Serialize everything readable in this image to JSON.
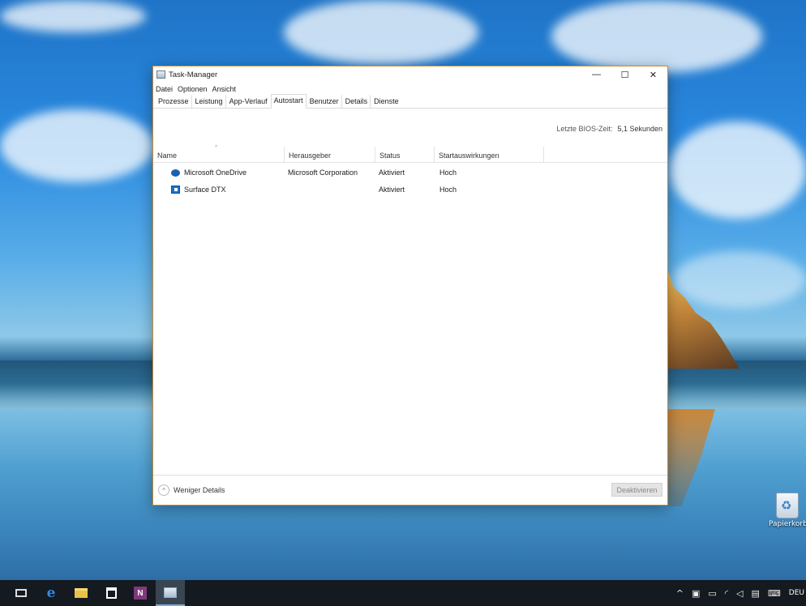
{
  "window": {
    "title": "Task-Manager",
    "controls": {
      "minimize": "—",
      "maximize": "☐",
      "close": "✕"
    }
  },
  "menu": [
    "Datei",
    "Optionen",
    "Ansicht"
  ],
  "tabs": [
    {
      "label": "Prozesse",
      "active": false
    },
    {
      "label": "Leistung",
      "active": false
    },
    {
      "label": "App-Verlauf",
      "active": false
    },
    {
      "label": "Autostart",
      "active": true
    },
    {
      "label": "Benutzer",
      "active": false
    },
    {
      "label": "Details",
      "active": false
    },
    {
      "label": "Dienste",
      "active": false
    }
  ],
  "bios": {
    "label": "Letzte BIOS-Zeit:",
    "value": "5,1 Sekunden"
  },
  "table": {
    "sort_indicator": "^",
    "columns": [
      "Name",
      "Herausgeber",
      "Status",
      "Startauswirkungen"
    ],
    "rows": [
      {
        "icon": "onedrive-icon",
        "name": "Microsoft OneDrive",
        "publisher": "Microsoft Corporation",
        "status": "Aktiviert",
        "impact": "Hoch"
      },
      {
        "icon": "surface-icon",
        "name": "Surface DTX",
        "publisher": "",
        "status": "Aktiviert",
        "impact": "Hoch"
      }
    ]
  },
  "footer": {
    "less_details": "Weniger Details",
    "disable_button": "Deaktivieren",
    "chevron": "^"
  },
  "desktop": {
    "recycle_bin_label": "Papierkorb"
  },
  "taskbar": {
    "icons": [
      "task-view-icon",
      "edge-icon",
      "file-explorer-icon",
      "store-icon",
      "onenote-icon",
      "task-manager-icon"
    ],
    "edge_glyph": "e",
    "onenote_glyph": "N",
    "tray": {
      "chevron": "^",
      "language": "DEU"
    }
  },
  "colors": {
    "window_border": "#c98a2a",
    "taskbar": "#141a20",
    "onedrive_blue": "#1b5fb0",
    "onenote_purple": "#80397b"
  }
}
